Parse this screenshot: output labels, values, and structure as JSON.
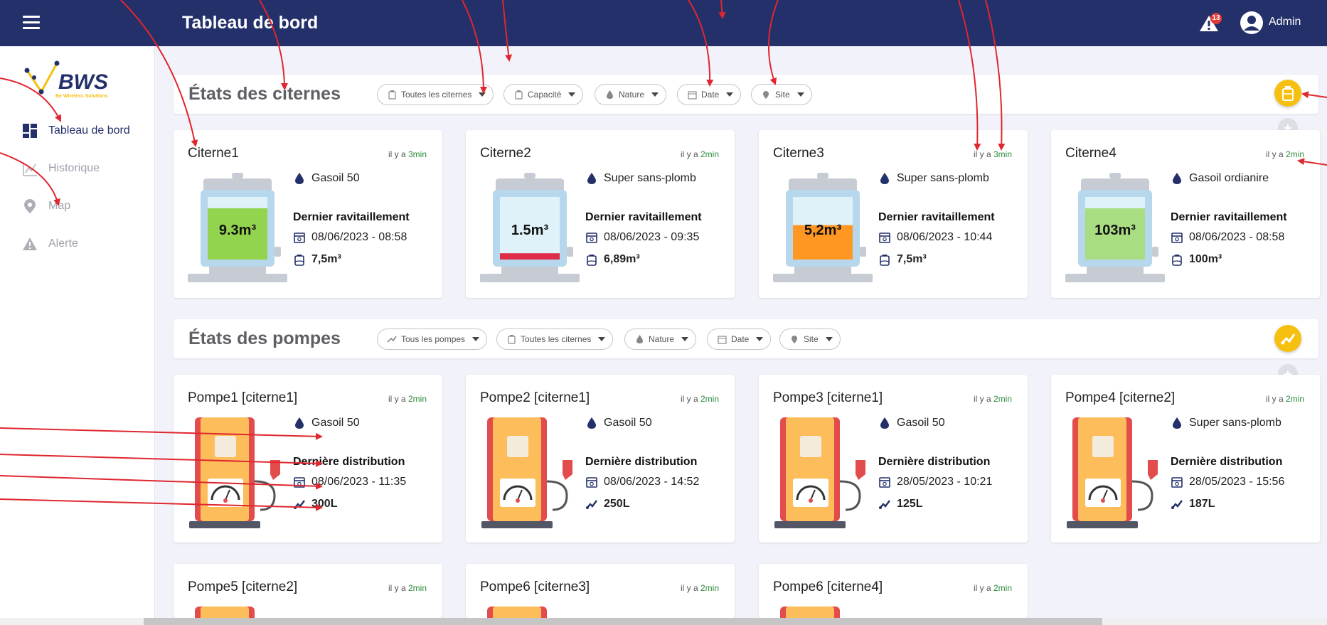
{
  "header": {
    "title": "Tableau de bord",
    "alert_count": "13",
    "user_name": "Admin"
  },
  "logo": {
    "brand": "BWS",
    "tagline": "Be Wireless Solutions"
  },
  "sidebar": {
    "items": [
      {
        "label": "Tableau de bord",
        "icon": "dashboard-icon",
        "active": true
      },
      {
        "label": "Historique",
        "icon": "chart-icon",
        "active": false
      },
      {
        "label": "Map",
        "icon": "map-pin-icon",
        "active": false
      },
      {
        "label": "Alerte",
        "icon": "warning-icon",
        "active": false
      }
    ]
  },
  "tanks_section": {
    "title": "États des citernes",
    "filters": [
      "Toutes les citernes",
      "Capacité",
      "Nature",
      "Date",
      "Site"
    ]
  },
  "pumps_section": {
    "title": "États des pompes",
    "filters": [
      "Tous les pompes",
      "Toutes les citernes",
      "Nature",
      "Date",
      "Site"
    ]
  },
  "time_prefix": "il y a",
  "tanks": [
    {
      "name": "Citerne1",
      "ago": "3min",
      "fuel": "Gasoil 50",
      "level_label": "9.3m³",
      "level": 0.82,
      "fill_color": "#93d44e",
      "last_heading": "Dernier ravitaillement",
      "date": "08/06/2023 - 08:58",
      "volume": "7,5m³"
    },
    {
      "name": "Citerne2",
      "ago": "2min",
      "fuel": "Super sans-plomb",
      "level_label": "1.5m³",
      "level": 0.1,
      "fill_color": "#de2c49",
      "last_heading": "Dernier ravitaillement",
      "date": "08/06/2023 - 09:35",
      "volume": "6,89m³"
    },
    {
      "name": "Citerne3",
      "ago": "3min",
      "fuel": "Super sans-plomb",
      "level_label": "5,2m³",
      "level": 0.55,
      "fill_color": "#ff9722",
      "last_heading": "Dernier ravitaillement",
      "date": "08/06/2023 - 10:44",
      "volume": "7,5m³"
    },
    {
      "name": "Citerne4",
      "ago": "2min",
      "fuel": "Gasoil ordianire",
      "level_label": "103m³",
      "level": 0.82,
      "fill_color": "#a8dd82",
      "last_heading": "Dernier ravitaillement",
      "date": "08/06/2023 - 08:58",
      "volume": "100m³"
    }
  ],
  "pumps": [
    {
      "name": "Pompe1 [citerne1]",
      "ago": "2min",
      "fuel": "Gasoil 50",
      "last_heading": "Dernière distribution",
      "date": "08/06/2023 - 11:35",
      "volume": "300L"
    },
    {
      "name": "Pompe2 [citerne1]",
      "ago": "2min",
      "fuel": "Gasoil 50",
      "last_heading": "Dernière distribution",
      "date": "08/06/2023 - 14:52",
      "volume": "250L"
    },
    {
      "name": "Pompe3 [citerne1]",
      "ago": "2min",
      "fuel": "Gasoil 50",
      "last_heading": "Dernière distribution",
      "date": "28/05/2023 - 10:21",
      "volume": "125L"
    },
    {
      "name": "Pompe4 [citerne2]",
      "ago": "2min",
      "fuel": "Super sans-plomb",
      "last_heading": "Dernière distribution",
      "date": "28/05/2023 - 15:56",
      "volume": "187L"
    },
    {
      "name": "Pompe5 [citerne2]",
      "ago": "2min"
    },
    {
      "name": "Pompe6 [citerne3]",
      "ago": "2min"
    },
    {
      "name": "Pompe6 [citerne4]",
      "ago": "2min"
    }
  ],
  "colors": {
    "header": "#23306a",
    "accent": "#f5c010",
    "annotation": "#e0262f"
  }
}
